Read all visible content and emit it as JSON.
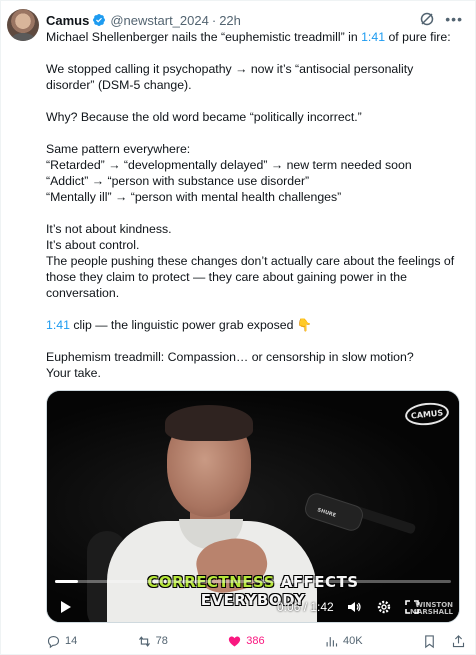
{
  "author": {
    "name": "Camus",
    "handle": "@newstart_2024",
    "separator": "·",
    "time": "22h"
  },
  "tweet": {
    "line1_pre": "Michael Shellenberger nails the “euphemistic treadmill” in ",
    "line1_link": "1:41",
    "line1_post": " of pure fire:",
    "p2": "We stopped calling it psychopathy → now it’s “antisocial personality disorder” (DSM-5 change).",
    "p3": "Why? Because the old word became “politically incorrect.”",
    "p4_1": "Same pattern everywhere:",
    "p4_2": "“Retarded” → “developmentally delayed” → new term needed soon",
    "p4_3": "“Addict” → “person with substance use disorder”",
    "p4_4": "“Mentally ill” → “person with mental health challenges”",
    "p5_1": "It’s not about kindness.",
    "p5_2": "It’s about control.",
    "p5_3": "The people pushing these changes don’t actually care about the feelings of those they claim to protect — they care about gaining power in the conversation.",
    "p6_link": "1:41",
    "p6_post": " clip — the linguistic power grab exposed 👇",
    "p7_1": "Euphemism treadmill: Compassion… or censorship in slow motion?",
    "p7_2": "Your take."
  },
  "video": {
    "caption_highlight": "CORRECTNESS",
    "caption_rest": " AFFECTS",
    "caption_line2": "EVERYBODY",
    "watermark": "CAMUS",
    "signature_1": "WINSTON",
    "signature_2": "MARSHALL",
    "mic_brand": "SHURE",
    "timecode": "0:06 / 1:42",
    "progress_fraction": 0.059
  },
  "actions": {
    "replies": "14",
    "reposts": "78",
    "likes": "386",
    "views": "40K"
  },
  "colors": {
    "link": "#1d9bf0",
    "verified": "#1d9bf0",
    "like": "#f91880",
    "caption_highlight": "#b6e63a",
    "muted": "#536471"
  }
}
